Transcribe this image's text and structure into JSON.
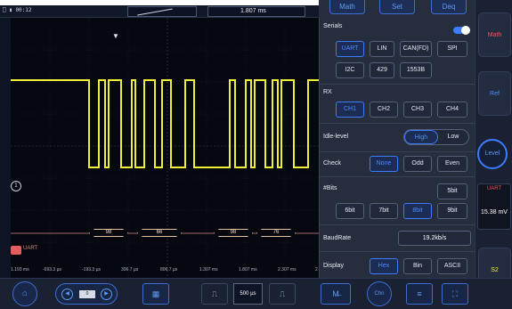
{
  "top_bar": {
    "status_text": "⎕ ▮ 00:12",
    "time_readout": "1.807 ms"
  },
  "panel_top": {
    "left_label": "Math",
    "set_label": "Set",
    "right_label": "Deq"
  },
  "waveform": {
    "channel_marker": "1",
    "bus_label": "UART",
    "decoded": [
      "98",
      "66",
      "98",
      "76"
    ]
  },
  "time_axis": [
    "1.193 ms",
    "-693.3 µs",
    "-193.3 µs",
    "306.7 µs",
    "806.7 µs",
    "1.307 ms",
    "1.807 ms",
    "2.307 ms",
    "2"
  ],
  "panel": {
    "serials_title": "Serials",
    "serial_protocols": [
      "UART",
      "LIN",
      "CAN(FD)",
      "SPI",
      "I2C",
      "429",
      "1553B"
    ],
    "serial_selected": "UART",
    "rx_title": "RX",
    "rx_channels": [
      "CH1",
      "CH2",
      "CH3",
      "CH4"
    ],
    "rx_selected": "CH1",
    "idle_title": "Idle-level",
    "idle_options": [
      "High",
      "Low"
    ],
    "idle_selected": "High",
    "check_title": "Check",
    "check_options": [
      "None",
      "Odd",
      "Even"
    ],
    "check_selected": "None",
    "bits_title": "#Bits",
    "bits_options": [
      "5bit",
      "6bit",
      "7bit",
      "8bit",
      "9bit"
    ],
    "bits_selected": "8bit",
    "baud_title": "BaudRate",
    "baud_value": "19.2kb/s",
    "display_title": "Display",
    "display_options": [
      "Hex",
      "Bin",
      "ASCII"
    ],
    "display_selected": "Hex"
  },
  "right_col": {
    "math_label": "Math",
    "ref_label": "Ref",
    "level_label": "Level",
    "uart_header": "UART",
    "uart_value": "15.38 mV",
    "s2_label": "S2"
  },
  "bottom_bar": {
    "home_icon": "⌂",
    "nav_value": "0",
    "save_icon": "▦",
    "timebase": "500 µs",
    "pulse_wide_icon": "⎍",
    "pulse_narrow_icon": "⎍",
    "func_label": "M̶",
    "ch_label": "Chn"
  },
  "colors": {
    "accent": "#3d7bff",
    "trace": "#f1ef3a",
    "bus": "#e25e5e",
    "panel_bg": "#262d3d"
  }
}
